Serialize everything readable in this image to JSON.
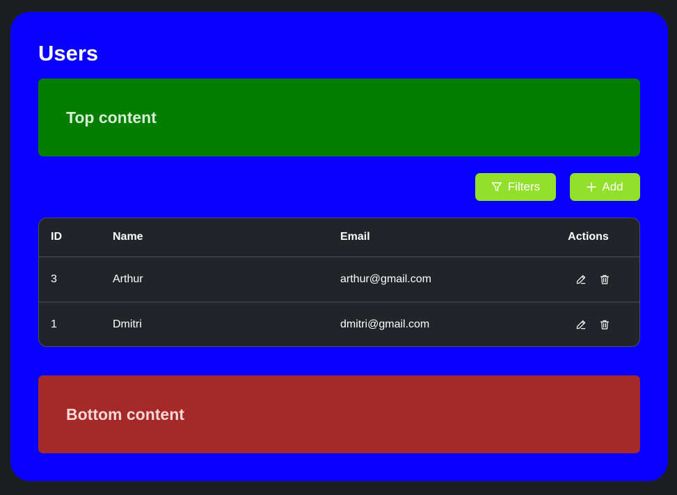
{
  "page": {
    "title": "Users"
  },
  "top_block": {
    "text": "Top content"
  },
  "toolbar": {
    "filters_label": "Filters",
    "add_label": "Add"
  },
  "table": {
    "headers": {
      "id": "ID",
      "name": "Name",
      "email": "Email",
      "actions": "Actions"
    },
    "rows": [
      {
        "id": "3",
        "name": "Arthur",
        "email": "arthur@gmail.com",
        "actions": [
          "edit-icon",
          "trash-icon"
        ]
      },
      {
        "id": "1",
        "name": "Dmitri",
        "email": "dmitri@gmail.com",
        "actions": [
          "edit-icon",
          "trash-icon"
        ]
      }
    ]
  },
  "bottom_block": {
    "text": "Bottom content"
  },
  "colors": {
    "background": "#1b1e21",
    "panel": "#0a00ff",
    "top_block": "#057d00",
    "bottom_block": "#a6292a",
    "button": "#93e02c",
    "table": "#212529"
  }
}
